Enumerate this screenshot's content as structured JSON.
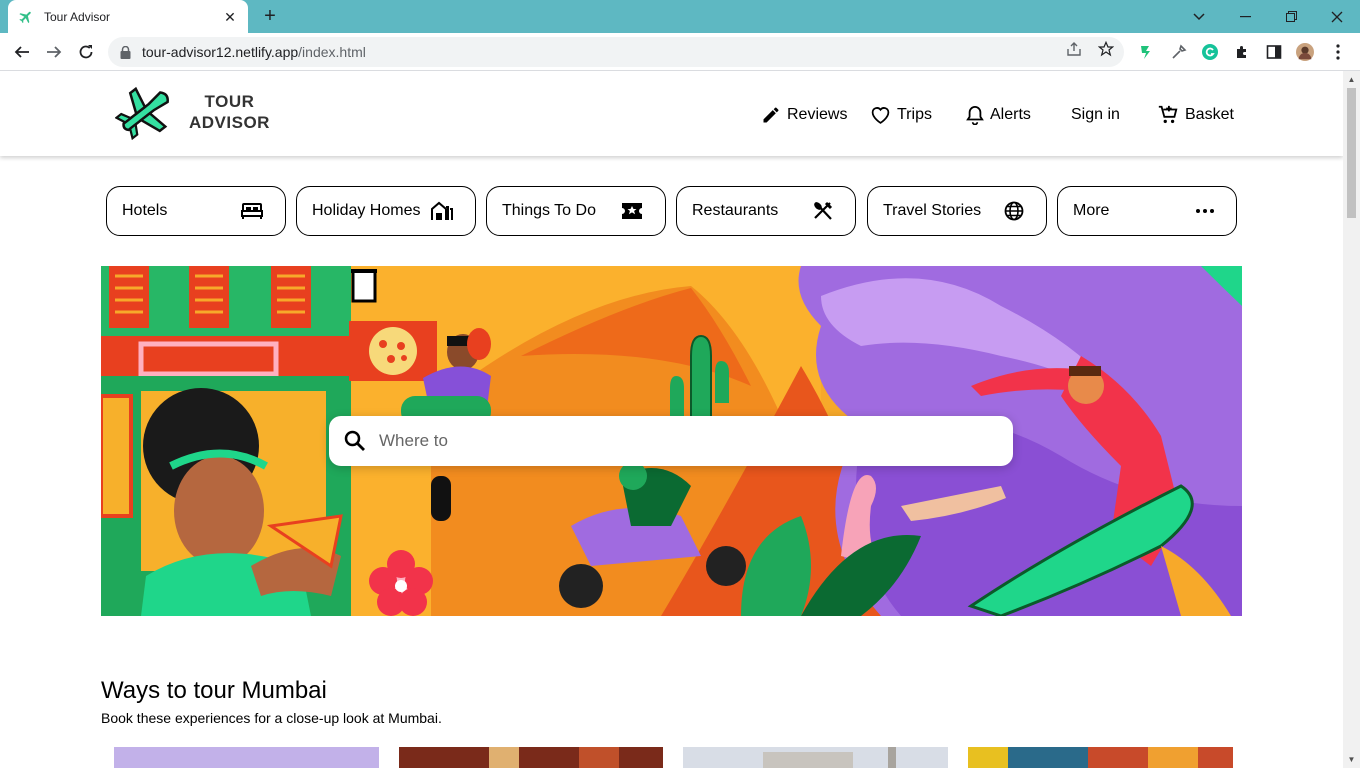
{
  "browser": {
    "tab_title": "Tour Advisor",
    "url_host": "tour-advisor12.netlify.app",
    "url_path": "/index.html"
  },
  "site": {
    "logo_line1": "TOUR",
    "logo_line2": "ADVISOR",
    "nav": {
      "reviews": "Reviews",
      "trips": "Trips",
      "alerts": "Alerts",
      "signin": "Sign in",
      "basket": "Basket"
    },
    "categories": [
      "Hotels",
      "Holiday Homes",
      "Things To Do",
      "Restaurants",
      "Travel Stories",
      "More"
    ],
    "search_placeholder": "Where to",
    "section": {
      "title": "Ways to tour Mumbai",
      "subtitle": "Book these experiences for a close-up look at Mumbai."
    }
  },
  "colors": {
    "accent": "#34e0a1",
    "chrome_bar": "#5eb8c2"
  }
}
